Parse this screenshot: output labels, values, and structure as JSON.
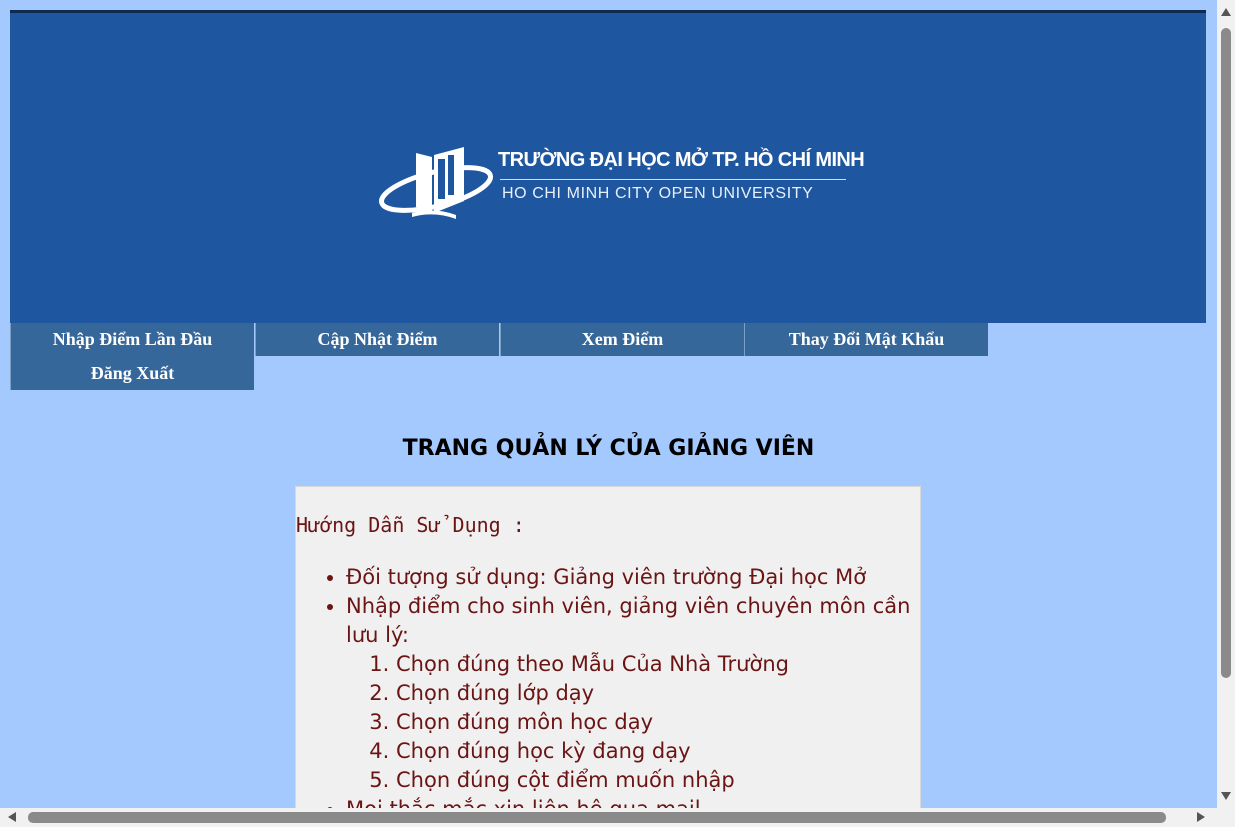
{
  "banner": {
    "school_name_vi": "TRƯỜNG ĐẠI HỌC MỞ TP. HỒ CHÍ MINH",
    "school_name_en": "HO CHI MINH CITY OPEN UNIVERSITY",
    "background_color": "#1e56a0"
  },
  "nav": {
    "items": [
      {
        "label": "Nhập Điểm Lần Đầu"
      },
      {
        "label": "Cập Nhật Điểm"
      },
      {
        "label": "Xem Điểm"
      },
      {
        "label": "Thay Đổi Mật Khẩu"
      },
      {
        "label": "Đăng Xuất"
      }
    ],
    "color": "#36679a"
  },
  "main": {
    "title": "TRANG QUẢN LÝ CỦA GIẢNG VIÊN",
    "guide": {
      "heading": "Hướng Dẫn Sử Dụng :",
      "items": [
        "Đối tượng sử dụng: Giảng viên trường Đại học Mở",
        "Nhập điểm cho sinh viên, giảng viên chuyên môn cần lưu lý:",
        "Mọi thắc mắc xin liên hệ qua mail"
      ],
      "steps": [
        "Chọn đúng theo Mẫu Của Nhà Trường",
        "Chọn đúng lớp dạy",
        "Chọn đúng môn học dạy",
        "Chọn đúng học kỳ đang dạy",
        "Chọn đúng cột điểm muốn nhập"
      ]
    }
  },
  "colors": {
    "page_background": "#a3c9ff",
    "guide_text": "#6b1414"
  }
}
